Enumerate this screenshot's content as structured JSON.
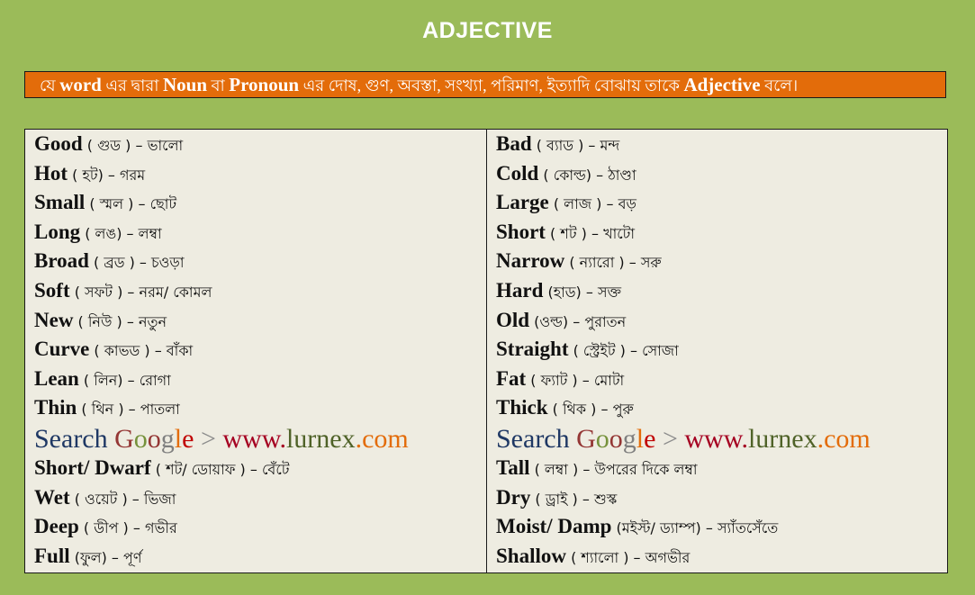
{
  "title": "ADJECTIVE",
  "definition": {
    "parts": [
      {
        "text": "যে ",
        "bold": false
      },
      {
        "text": "word",
        "bold": true
      },
      {
        "text": " এর দ্বারা ",
        "bold": false
      },
      {
        "text": "Noun",
        "bold": true
      },
      {
        "text": "  বা ",
        "bold": false
      },
      {
        "text": "Pronoun",
        "bold": true
      },
      {
        "text": "  এর দোষ, গুণ, অবস্তা, সংখ্যা, পরিমাণ, ইত্যাদি বোঝায় তাকে ",
        "bold": false
      },
      {
        "text": "Adjective",
        "bold": true
      },
      {
        "text": " বলে।",
        "bold": false
      }
    ]
  },
  "promo": {
    "segments": [
      {
        "text": "Search ",
        "color": "#1f3864"
      },
      {
        "text": "G",
        "color": "#943634"
      },
      {
        "text": "o",
        "color": "#76923c"
      },
      {
        "text": "o",
        "color": "#943634"
      },
      {
        "text": "g",
        "color": "#7f7f7f"
      },
      {
        "text": "l",
        "color": "#e36c0a"
      },
      {
        "text": "e",
        "color": "#c00000"
      },
      {
        "text": " > ",
        "color": "#8c8c8c"
      },
      {
        "text": "www.",
        "color": "#a50021"
      },
      {
        "text": "lurnex",
        "color": "#4f6228"
      },
      {
        "text": ".com",
        "color": "#e36c0a"
      }
    ]
  },
  "colors": {
    "background": "#9bbb59",
    "definition_bg": "#e36c0a",
    "table_bg": "#eeece1",
    "border": "#1a1a1a"
  },
  "left_column": {
    "top_rows": [
      {
        "en": "Good",
        "pron": " ( গুড ) – ",
        "mean": " ভালো"
      },
      {
        "en": "Hot",
        "pron": " ( হট) – ",
        "mean": " গরম"
      },
      {
        "en": "Small",
        "pron": " ( স্মল ) – ",
        "mean": "ছোট"
      },
      {
        "en": "Long",
        "pron": " ( লঙ) – ",
        "mean": " লম্বা"
      },
      {
        "en": "Broad",
        "pron": " ( ব্রড ) – ",
        "mean": " চওড়া"
      },
      {
        "en": "Soft",
        "pron": " ( সফট ) – ",
        "mean": " নরম/ কোমল"
      },
      {
        "en": "New",
        "pron": " ( নিউ ) – ",
        "mean": " নতুন"
      },
      {
        "en": "Curve",
        "pron": " ( কাভড ) – ",
        "mean": " বাঁকা"
      },
      {
        "en": "Lean",
        "pron": " ( লিন) – ",
        "mean": " রোগা"
      },
      {
        "en": "Thin",
        "pron": " ( থিন ) – ",
        "mean": "পাতলা"
      }
    ],
    "bottom_rows": [
      {
        "en": "Short/ Dwarf",
        "pron": " ( শট/ ডোয়াফ ) – ",
        "mean": " বেঁটে"
      },
      {
        "en": "Wet",
        "pron": " ( ওয়েট ) – ",
        "mean": " ভিজা"
      },
      {
        "en": "Deep",
        "pron": " ( ডীপ ) – ",
        "mean": " গভীর"
      },
      {
        "en": "Full",
        "pron": " (ফুল) – ",
        "mean": " পূর্ণ"
      }
    ]
  },
  "right_column": {
    "top_rows": [
      {
        "en": "Bad",
        "pron": " ( ব্যাড ) – ",
        "mean": "মন্দ"
      },
      {
        "en": "Cold",
        "pron": " ( কোল্ড) – ",
        "mean": " ঠাণ্ডা"
      },
      {
        "en": "Large",
        "pron": " ( লাজ ) – ",
        "mean": "বড়"
      },
      {
        "en": "Short",
        "pron": " ( শট ) – ",
        "mean": "খাটো"
      },
      {
        "en": "Narrow",
        "pron": " ( ন্যারো ) – ",
        "mean": "সরু"
      },
      {
        "en": "Hard",
        "pron": " (হাড) – ",
        "mean": "সক্ত"
      },
      {
        "en": "Old",
        "pron": " (ওল্ড) – ",
        "mean": "পুরাতন"
      },
      {
        "en": "Straight",
        "pron": " ( স্ট্রেইট ) – ",
        "mean": "সোজা"
      },
      {
        "en": "Fat",
        "pron": " ( ফ্যাট ) – ",
        "mean": "মোটা"
      },
      {
        "en": "Thick",
        "pron": " ( থিক ) – ",
        "mean": "পুরু"
      }
    ],
    "bottom_rows": [
      {
        "en": "Tall",
        "pron": " ( লম্বা ) – ",
        "mean": "উপরের দিকে লম্বা"
      },
      {
        "en": "Dry",
        "pron": " ( ড্রাই ) – ",
        "mean": "শুস্ক"
      },
      {
        "en": "Moist/ Damp",
        "pron": " (মইস্ট/ ড্যাম্প) – ",
        "mean": "স্যাঁতসেঁতে"
      },
      {
        "en": "Shallow",
        "pron": " ( শ্যালো ) – ",
        "mean": "অগভীর"
      }
    ]
  }
}
